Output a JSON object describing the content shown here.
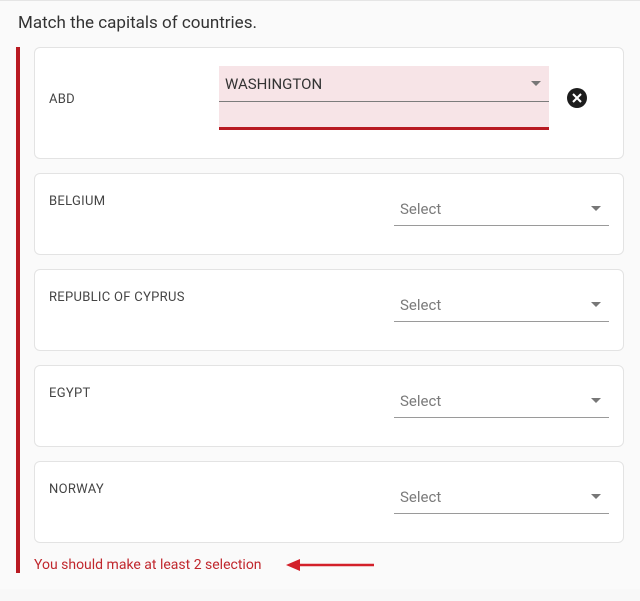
{
  "title": "Match the capitals of countries.",
  "placeholder": "Select",
  "rows": [
    {
      "country": "ABD",
      "value": "WASHINGTON",
      "error": true
    },
    {
      "country": "BELGIUM",
      "value": "",
      "error": false
    },
    {
      "country": "REPUBLIC OF CYPRUS",
      "value": "",
      "error": false
    },
    {
      "country": "EGYPT",
      "value": "",
      "error": false
    },
    {
      "country": "NORWAY",
      "value": "",
      "error": false
    }
  ],
  "validation": "You should make at least 2 selection",
  "icons": {
    "cancel": "cancel-icon",
    "dropdown": "chevron-down-icon"
  },
  "colors": {
    "accent": "#b81a22",
    "errorBg": "#f7e4e7"
  }
}
